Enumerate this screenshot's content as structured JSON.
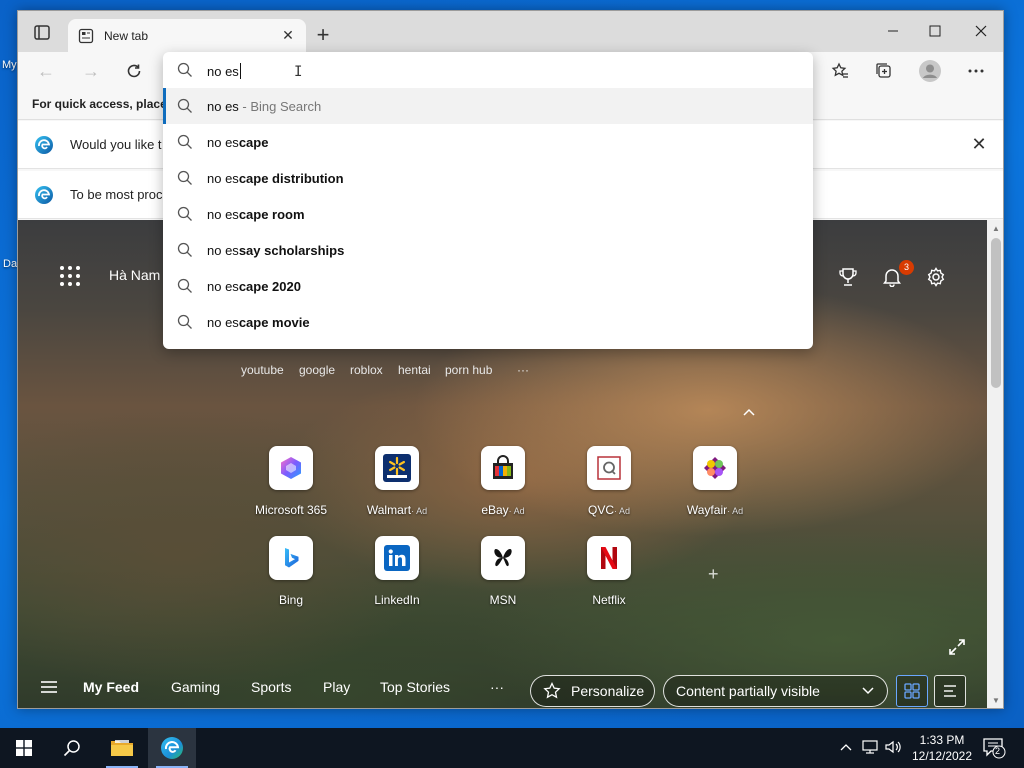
{
  "desktop": {
    "icon_label_1": "My",
    "icon_label_2": "Da"
  },
  "browser": {
    "tab": {
      "title": "New tab"
    },
    "favorites_bar": {
      "text": "For quick access, place y"
    },
    "infobars": [
      {
        "text": "Would you like t"
      },
      {
        "text": "To be most proc"
      }
    ]
  },
  "address_bar": {
    "query": "no es",
    "suggestions": [
      {
        "prefix": "no es",
        "bold": "",
        "suffix": " - Bing Search",
        "selected": true
      },
      {
        "prefix": "no es",
        "bold": "cape",
        "suffix": "",
        "selected": false
      },
      {
        "prefix": "no es",
        "bold": "cape distribution",
        "suffix": "",
        "selected": false
      },
      {
        "prefix": "no es",
        "bold": "cape room",
        "suffix": "",
        "selected": false
      },
      {
        "prefix": "no es",
        "bold": "say scholarships",
        "suffix": "",
        "selected": false
      },
      {
        "prefix": "no es",
        "bold": "cape 2020",
        "suffix": "",
        "selected": false
      },
      {
        "prefix": "no es",
        "bold": "cape movie",
        "suffix": "",
        "selected": false
      }
    ]
  },
  "newtab": {
    "location": "Hà Nam",
    "notification_count": "3",
    "quick_links": [
      "youtube",
      "google",
      "roblox",
      "hentai",
      "porn hub"
    ],
    "more": "···",
    "tiles": [
      {
        "label": "Microsoft 365",
        "ad": ""
      },
      {
        "label": "Walmart",
        "ad": "· Ad"
      },
      {
        "label": "eBay",
        "ad": "· Ad"
      },
      {
        "label": "QVC",
        "ad": "· Ad"
      },
      {
        "label": "Wayfair",
        "ad": "· Ad"
      },
      {
        "label": "Bing",
        "ad": ""
      },
      {
        "label": "LinkedIn",
        "ad": ""
      },
      {
        "label": "MSN",
        "ad": ""
      },
      {
        "label": "Netflix",
        "ad": ""
      }
    ],
    "feed": {
      "items": [
        "My Feed",
        "Gaming",
        "Sports",
        "Play",
        "Top Stories"
      ],
      "more": "···",
      "personalize": "Personalize",
      "content_visibility": "Content partially visible"
    }
  },
  "taskbar": {
    "time": "1:33 PM",
    "date": "12/12/2022",
    "notifications": "2"
  },
  "colors": {
    "accent": "#0f6cbd",
    "badge": "#d83b01",
    "taskbar": "#0e1621"
  }
}
